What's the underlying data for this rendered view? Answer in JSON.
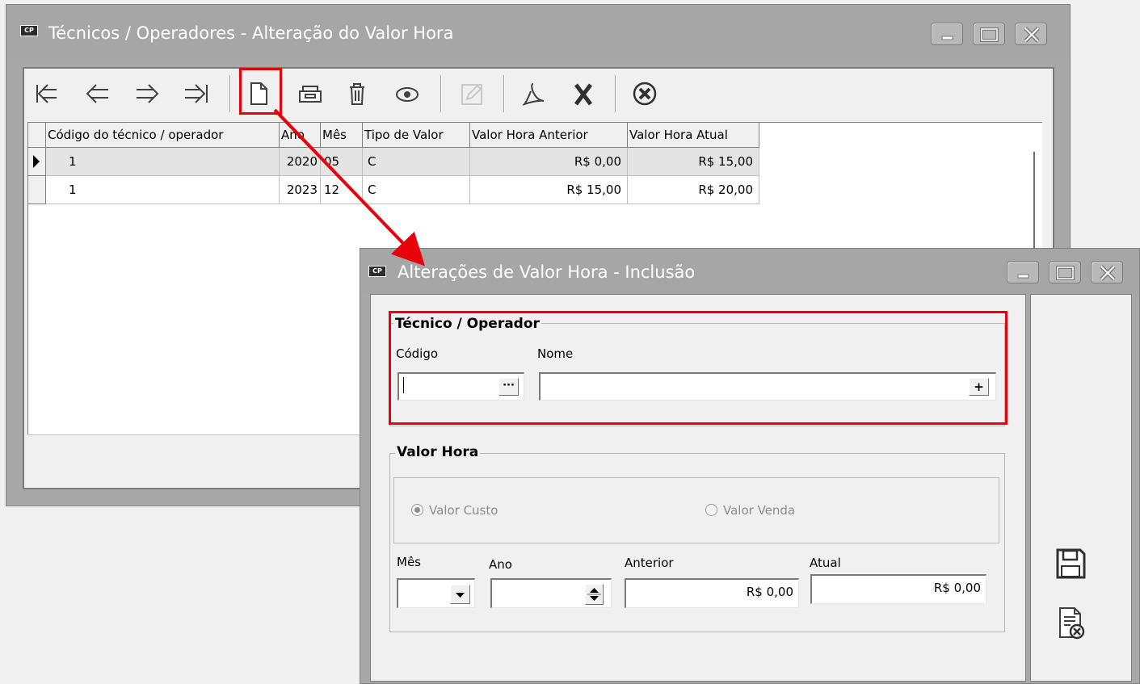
{
  "main_window": {
    "title": "Técnicos / Operadores - Alteração do Valor Hora",
    "icon_text": "CP"
  },
  "toolbar": {
    "buttons": [
      "first-record",
      "previous-record",
      "next-record",
      "last-record",
      "new-record",
      "open-record",
      "delete-record",
      "view-record",
      "edit-record",
      "pdf-export",
      "excel-export",
      "close"
    ]
  },
  "grid": {
    "columns": [
      "Código do técnico / operador",
      "Ano",
      "Mês",
      "Tipo de Valor",
      "Valor Hora Anterior",
      "Valor Hora Atual"
    ],
    "rows": [
      {
        "codigo": "1",
        "ano": "2020",
        "mes": "05",
        "tipo": "C",
        "anterior": "R$ 0,00",
        "atual": "R$ 15,00",
        "selected": true
      },
      {
        "codigo": "1",
        "ano": "2023",
        "mes": "12",
        "tipo": "C",
        "anterior": "R$ 15,00",
        "atual": "R$ 20,00",
        "selected": false
      }
    ]
  },
  "dialog": {
    "title": "Alterações de Valor Hora  - Inclusão",
    "icon_text": "CP",
    "tecnico_group": {
      "title": "Técnico / Operador",
      "codigo_label": "Código",
      "codigo_value": "",
      "nome_label": "Nome",
      "nome_value": "",
      "lookup_button": "···",
      "add_button": "+"
    },
    "valor_group": {
      "title": "Valor Hora",
      "radio_custo": "Valor Custo",
      "radio_venda": "Valor Venda",
      "selected": "Valor Custo",
      "mes_label": "Mês",
      "mes_value": "",
      "ano_label": "Ano",
      "ano_value": "",
      "anterior_label": "Anterior",
      "anterior_value": "R$ 0,00",
      "atual_label": "Atual",
      "atual_value": "R$ 0,00"
    }
  },
  "colors": {
    "highlight": "#e8000b",
    "title_bar": "#a6a6a6",
    "window_bg": "#f0f0f0"
  }
}
